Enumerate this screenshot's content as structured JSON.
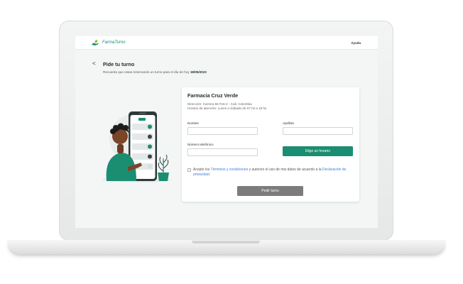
{
  "header": {
    "logo_text": "FarmaTurno",
    "help_label": "Ayuda"
  },
  "page": {
    "back_label": "<",
    "title": "Pide tu turno",
    "subtitle_prefix": "Recuerda que estas reservando un turno para el día de hoy",
    "date": "18/05/2023"
  },
  "pharmacy": {
    "name": "Farmacia Cruz Verde",
    "address": "Dirección: Carrera 56 #15-2 - Cali, Colombia",
    "hours": "Horario de atención: Lunes a Sábado de 07 hs a 19 hs"
  },
  "form": {
    "name_label": "Nombre",
    "name_value": "",
    "lastname_label": "Apellido",
    "lastname_value": "",
    "phone_label": "Número telefónico",
    "phone_value": "",
    "schedule_button": "Elige un horario",
    "consent_prefix": "Acepto los",
    "consent_terms": "Términos y condiciones",
    "consent_middle": "y autorizo el uso de mis datos de acuerdo a la",
    "consent_privacy": "Declaración de privacidad",
    "consent_suffix": ".",
    "submit_button": "Pedir turno"
  },
  "colors": {
    "brand": "#1b8e72",
    "link": "#3c7be0",
    "disabled_button": "#7c7c7c"
  },
  "icons": {
    "logo": "pharmacy-hand-icon",
    "back": "chevron-left-icon",
    "checkbox": "checkbox-unchecked"
  }
}
